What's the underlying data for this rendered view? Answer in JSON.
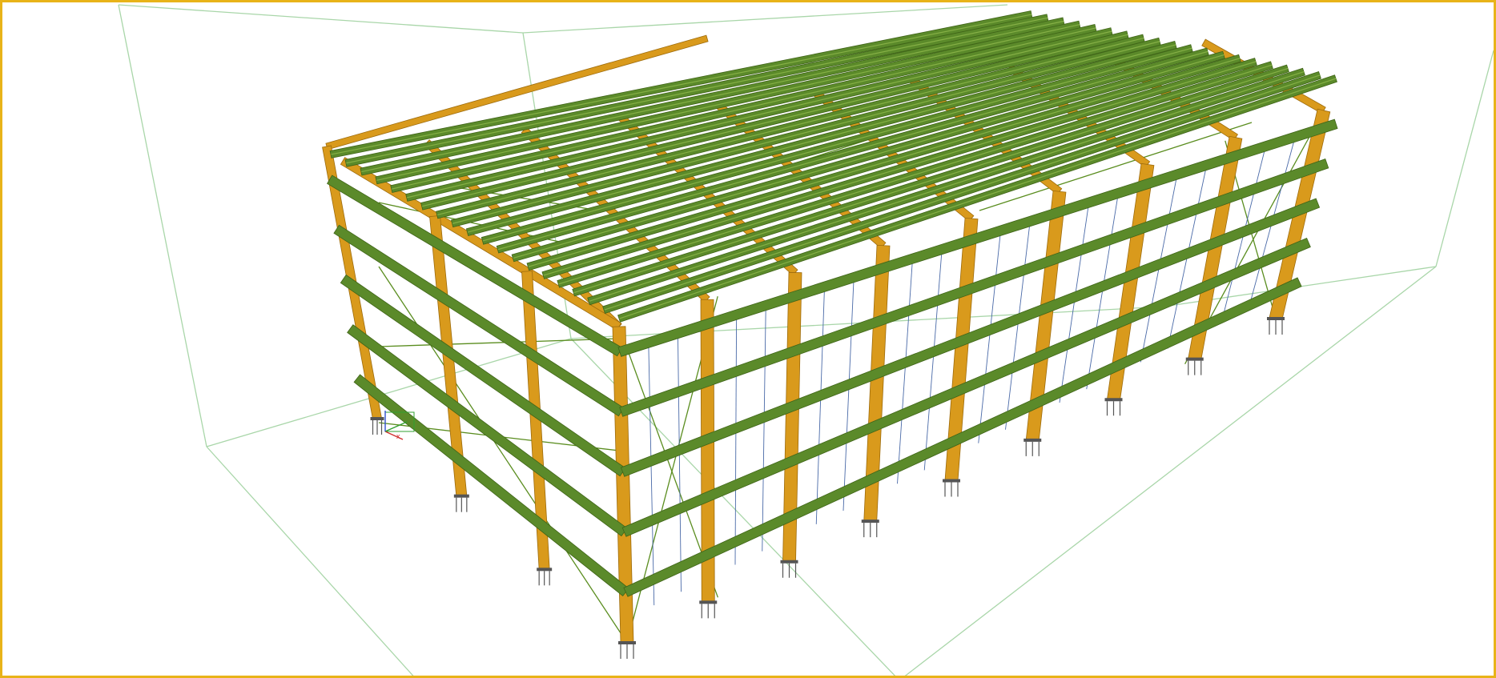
{
  "viewport": {
    "frame_color": "#e8b319",
    "background": "#ffffff"
  },
  "model": {
    "kind": "steel-frame-building",
    "frames": 9,
    "roof_purlins": 20,
    "wall_girt_rows": 5,
    "colors": {
      "purlin_green": "#5b8a2a",
      "purlin_dark": "#3f6418",
      "purlin_light": "#86b046",
      "column_orange": "#d99a1c",
      "column_dark": "#9d6b0c",
      "bracing": "#5a8d1f",
      "sag_rod_blue": "#4a6aa8",
      "bounding_box": "#a9d6a9",
      "base_plate": "#555555",
      "axis_x": "#d03030",
      "axis_y": "#30a030",
      "axis_z": "#3050d0"
    }
  },
  "axis_gizmo": {
    "x_label": "x",
    "icon": "coordinate-axes-icon"
  }
}
